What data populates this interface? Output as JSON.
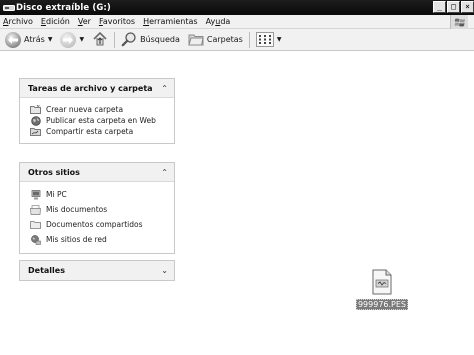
{
  "window": {
    "title": "Disco extraíble (G:)",
    "buttons": [
      "_",
      "□",
      "×"
    ]
  },
  "menu": {
    "items": [
      {
        "pre": "",
        "u": "A",
        "post": "rchivo"
      },
      {
        "pre": "",
        "u": "E",
        "post": "dición"
      },
      {
        "pre": "",
        "u": "V",
        "post": "er"
      },
      {
        "pre": "",
        "u": "F",
        "post": "avoritos"
      },
      {
        "pre": "",
        "u": "H",
        "post": "erramientas"
      },
      {
        "pre": "Ay",
        "u": "u",
        "post": "da"
      }
    ]
  },
  "toolbar": {
    "back_label": "Atrás",
    "search_label": "Búsqueda",
    "folders_label": "Carpetas"
  },
  "panels": {
    "tasks": {
      "title": "Tareas de archivo y carpeta",
      "chevron": "⌃",
      "items": [
        "Crear nueva carpeta",
        "Publicar esta carpeta en Web",
        "Compartir esta carpeta"
      ]
    },
    "places": {
      "title": "Otros sitios",
      "chevron": "⌃",
      "items": [
        "Mi PC",
        "Mis documentos",
        "Documentos compartidos",
        "Mis sitios de red"
      ]
    },
    "details": {
      "title": "Detalles",
      "chevron": "⌄"
    }
  },
  "files": [
    {
      "name": "999976.PES"
    }
  ]
}
